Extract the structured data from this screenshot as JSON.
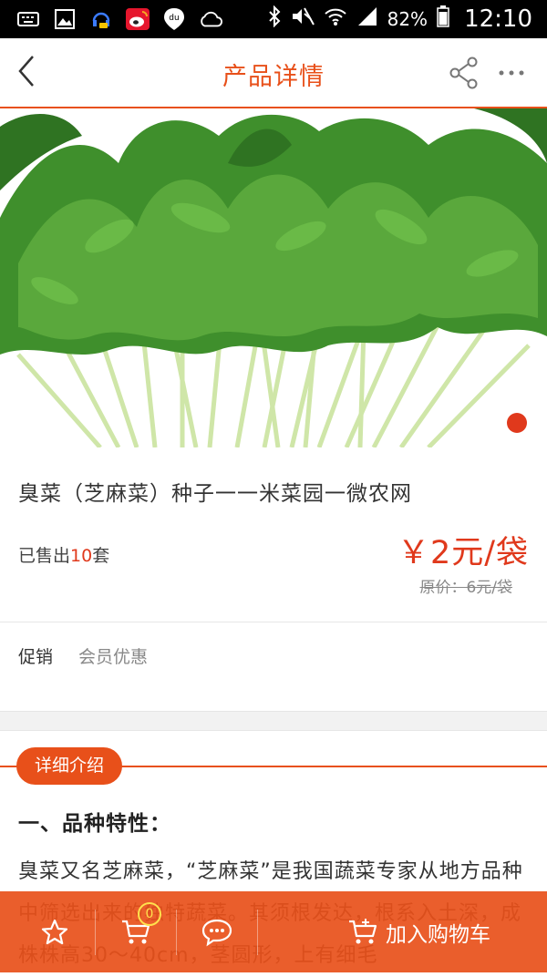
{
  "status_bar": {
    "battery": "82%",
    "time": "12:10",
    "icons": [
      "keyboard-icon",
      "image-icon",
      "headset-icon",
      "weibo-icon",
      "du-icon",
      "cloud-icon",
      "bluetooth-icon",
      "mute-icon",
      "wifi-icon",
      "signal-icon",
      "battery-icon"
    ]
  },
  "header": {
    "title": "产品详情"
  },
  "product": {
    "title": "臭菜（芝麻菜）种子一一米菜园一微农网",
    "sold_prefix": "已售出",
    "sold_count": "10",
    "sold_unit": "套",
    "price": "￥2元/袋",
    "original_price": "原价：6元/袋",
    "carousel_dots": 1,
    "carousel_active": 1
  },
  "promotion": {
    "label": "促销",
    "value": "会员优惠"
  },
  "detail": {
    "tab_label": "详细介绍",
    "heading": "一、品种特性：",
    "paragraph": "臭菜又名芝麻菜，“芝麻菜”是我国蔬菜专家从地方品种中筛选出来的独特蔬菜。其须根发达，根系入土深，成株株高30～40cm，茎圆形，上有细毛"
  },
  "bottom_bar": {
    "cart_count": "0",
    "add_to_cart": "加入购物车"
  },
  "colors": {
    "accent": "#e8501a",
    "price": "#e0391c",
    "badge": "#ffe14d"
  }
}
